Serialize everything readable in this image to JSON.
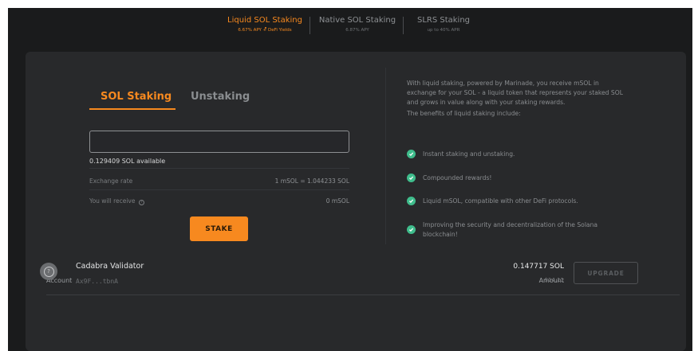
{
  "top_tabs": [
    {
      "title": "Liquid SOL Staking",
      "subtitle": "6.67% APY + DeFi Yields",
      "active": true
    },
    {
      "title": "Native SOL Staking",
      "subtitle": "6.87% APY",
      "active": false
    },
    {
      "title": "SLRS Staking",
      "subtitle": "up to 40% APR",
      "active": false
    }
  ],
  "stake_tabs": {
    "stake": "SOL Staking",
    "unstake": "Unstaking"
  },
  "amount_input": {
    "value": "",
    "placeholder": ""
  },
  "available": "0.129409 SOL available",
  "exchange_rate": {
    "label": "Exchange rate",
    "value": "1 mSOL = 1.044233 SOL"
  },
  "receive": {
    "label": "You will receive",
    "value": "0 mSOL"
  },
  "stake_button": "STAKE",
  "info": {
    "intro": "With liquid staking, powered by Marinade, you receive mSOL in exchange for your SOL - a liquid token that represents your staked SOL and grows in value along with your staking rewards.",
    "benefits_title": "The benefits of liquid staking include:",
    "benefits": [
      "Instant staking and unstaking.",
      "Compounded rewards!",
      "Liquid mSOL, compatible with other DeFi protocols.",
      "Improving the security and decentralization of the Solana blockchain!"
    ]
  },
  "accounts": {
    "headers": {
      "account": "Account",
      "amount": "Amount"
    },
    "rows": [
      {
        "name": "Cadabra Validator",
        "address": "Ax9F...tbnA",
        "amount": "0.147717 SOL",
        "usd": "$14.11",
        "action": "UPGRADE"
      }
    ]
  },
  "colors": {
    "accent": "#f7891f",
    "check": "#3fbd8c",
    "panel": "#28292b",
    "background": "#1a1b1c"
  }
}
